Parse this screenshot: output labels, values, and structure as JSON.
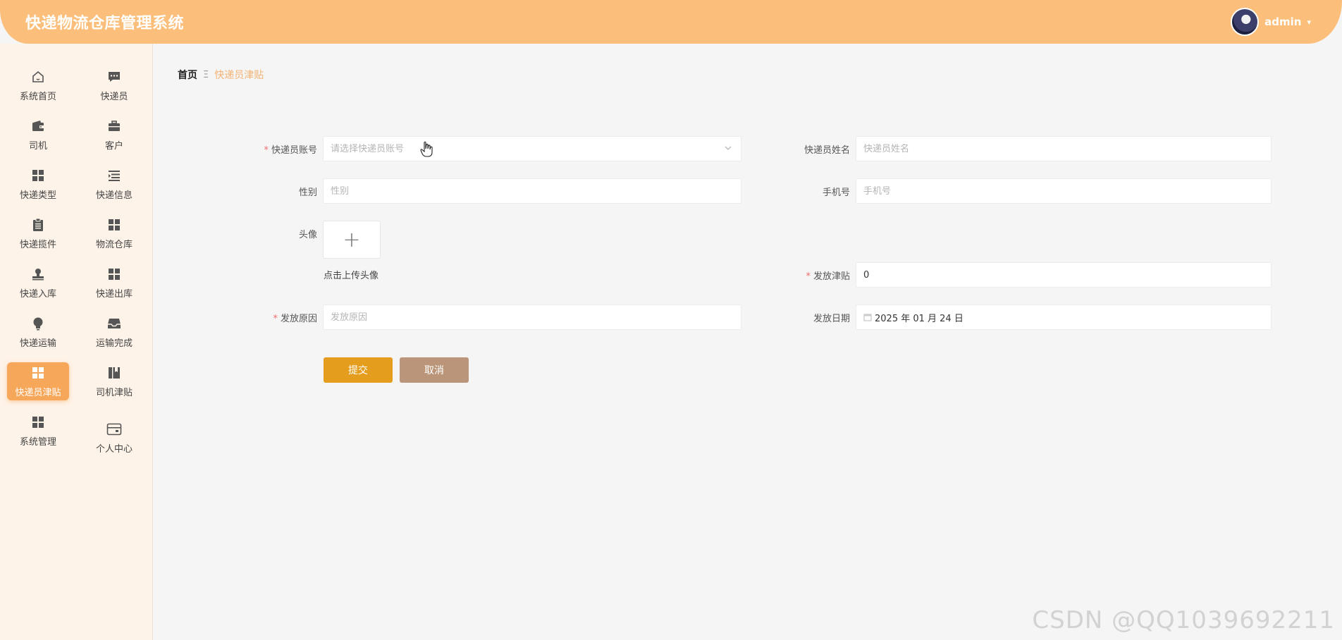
{
  "header": {
    "title": "快递物流仓库管理系统",
    "username": "admin",
    "caret": "▾"
  },
  "sidebar": {
    "items": [
      {
        "label": "系统首页",
        "icon": "home-icon"
      },
      {
        "label": "快递员",
        "icon": "chat-icon"
      },
      {
        "label": "司机",
        "icon": "wallet-icon"
      },
      {
        "label": "客户",
        "icon": "briefcase-icon"
      },
      {
        "label": "快递类型",
        "icon": "grid-icon"
      },
      {
        "label": "快递信息",
        "icon": "list-icon"
      },
      {
        "label": "快递揽件",
        "icon": "clipboard-icon"
      },
      {
        "label": "物流仓库",
        "icon": "grid-icon"
      },
      {
        "label": "快递入库",
        "icon": "stamp-icon"
      },
      {
        "label": "快递出库",
        "icon": "grid-icon"
      },
      {
        "label": "快递运输",
        "icon": "bulb-icon"
      },
      {
        "label": "运输完成",
        "icon": "inbox-icon"
      },
      {
        "label": "快递员津贴",
        "icon": "grid-icon",
        "active": true
      },
      {
        "label": "司机津贴",
        "icon": "book-icon"
      },
      {
        "label": "系统管理",
        "icon": "grid-icon"
      },
      {
        "label": "个人中心",
        "icon": "card-icon"
      }
    ]
  },
  "breadcrumb": {
    "home": "首页",
    "separator": "Ξ",
    "current": "快递员津贴"
  },
  "form": {
    "courier_account": {
      "label": "快递员账号",
      "placeholder": "请选择快递员账号",
      "required": true
    },
    "courier_name": {
      "label": "快递员姓名",
      "placeholder": "快递员姓名"
    },
    "gender": {
      "label": "性别",
      "placeholder": "性别"
    },
    "phone": {
      "label": "手机号",
      "placeholder": "手机号"
    },
    "avatar": {
      "label": "头像",
      "plus": "+",
      "hint": "点击上传头像"
    },
    "allowance": {
      "label": "发放津贴",
      "value": "0",
      "required": true
    },
    "reason": {
      "label": "发放原因",
      "placeholder": "发放原因",
      "required": true
    },
    "issue_date": {
      "label": "发放日期",
      "value": "2025 年 01 月 24 日"
    },
    "submit_label": "提交",
    "cancel_label": "取消"
  },
  "watermark": "CSDN @QQ1039692211",
  "colors": {
    "header": "#fbbf7b",
    "sidebar_bg": "#fef3e8",
    "active_menu": "#f7a75a",
    "submit": "#e59d1e",
    "cancel": "#bb9579",
    "breadcrumb_current": "#f3b273"
  }
}
